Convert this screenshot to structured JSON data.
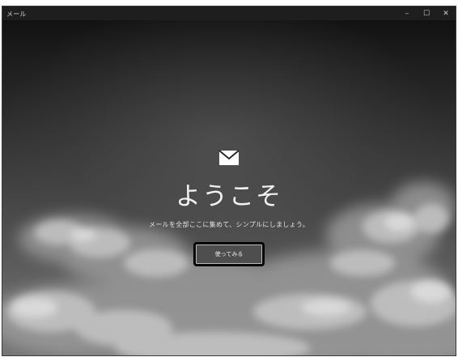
{
  "window": {
    "title": "メール",
    "controls": {
      "minimize": "–",
      "maximize": "☐",
      "close": "✕"
    }
  },
  "welcome": {
    "icon": "mail-envelope-icon",
    "heading": "ようこそ",
    "subtitle": "メールを全部ここに集めて、シンプルにしましょう。",
    "button_label": "使ってみる"
  },
  "colors": {
    "titlebar_bg": "#1e1e1e",
    "button_bg": "#4e4e4e",
    "text": "#f2f2f2"
  }
}
